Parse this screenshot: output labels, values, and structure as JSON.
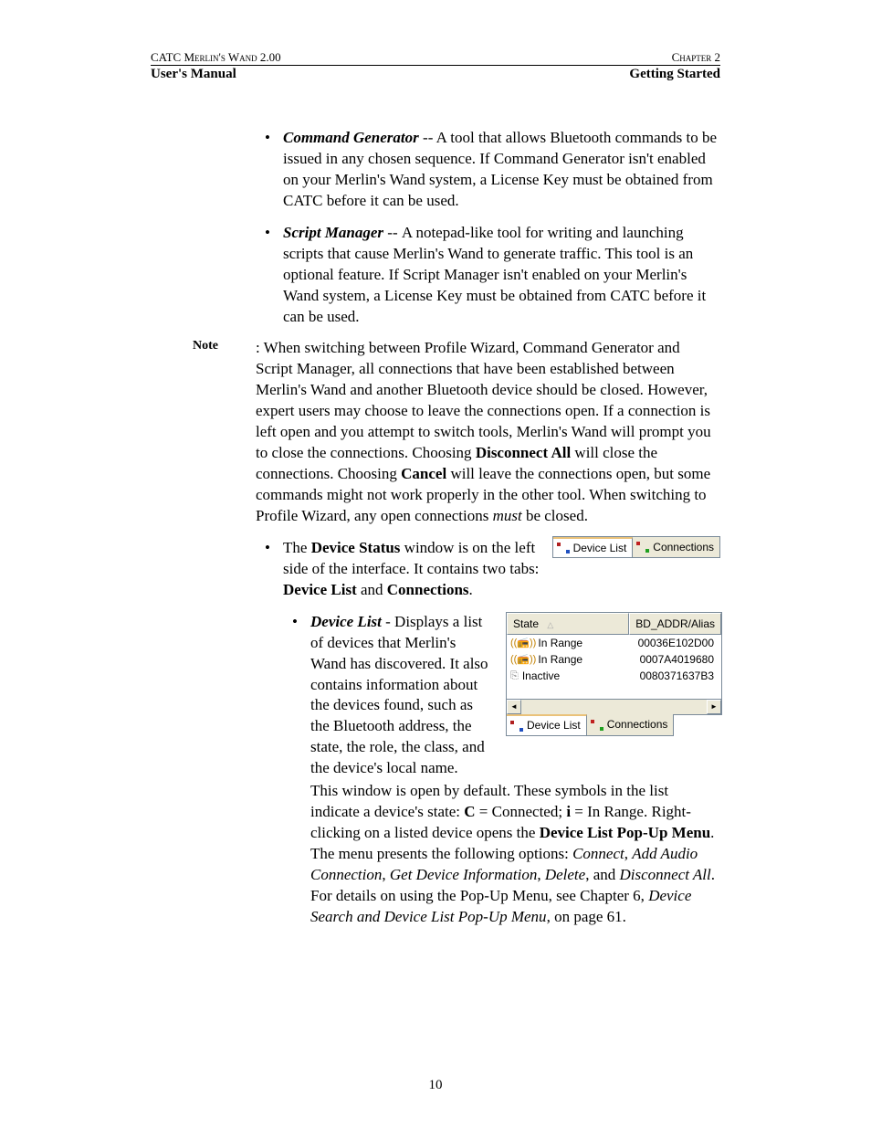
{
  "header": {
    "left": "CATC Merlin's Wand 2.00",
    "right": "Chapter 2"
  },
  "subheader": {
    "left": "User's Manual",
    "right": "Getting Started"
  },
  "cmdgen": {
    "title": "Command Generator",
    "sep": " -- ",
    "body": "A tool that allows Bluetooth commands to be issued in any chosen sequence. If Command Generator isn't enabled on your Merlin's Wand system, a License Key must be obtained from CATC before it can be used."
  },
  "scriptmgr": {
    "title": "Script Manager",
    "sep": " -- ",
    "body": "A notepad-like tool for writing and launching scripts that cause Merlin's Wand to generate traffic. This tool is an optional feature. If Script Manager isn't enabled on your Merlin's Wand system, a License Key must be obtained from CATC before it can be used."
  },
  "note": {
    "label": "Note",
    "colon": ": ",
    "p1": "When switching between Profile Wizard, Command Generator and Script Manager, all connections that have been established between Merlin's Wand and another Bluetooth device should be closed. However, expert users may choose to leave the connections open. If a connection is left open and you attempt to switch tools, Merlin's Wand will prompt you to close the connections. Choosing ",
    "da": "Disconnect All",
    "p2": " will close the connections. Choosing ",
    "cancel": "Cancel",
    "p3": " will leave the connections open, but some commands might not work properly in the other tool. When switching to Profile Wizard, any open connections ",
    "must": "must",
    "p4": " be closed."
  },
  "devstatus": {
    "p1": "The ",
    "b1": "Device Status",
    "p2": " window is on the left side of the interface. It contains two tabs: ",
    "b2": "Device List",
    "and": " and ",
    "b3": "Connections",
    "end": "."
  },
  "devlist": {
    "title": "Device List",
    "body": " - Displays a list of devices that Merlin's Wand has discovered. It also contains information about the devices found, such as the Bluetooth address, the state, the role, the class, and the device's local name."
  },
  "after": {
    "p1": "This window is open by default. These symbols in the list indicate a device's state: ",
    "C": "C",
    "eq1": " = Connected; ",
    "i": "i",
    "eq2": " = In Range. Right-clicking on a listed device opens the ",
    "b1": "Device List Pop-Up Menu",
    "p2": ". The menu presents the following options: ",
    "i1": "Connect",
    "c1": ", ",
    "i2": "Add Audio Connection",
    "c2": ", ",
    "i3": "Get Device Information",
    "c3": ", ",
    "i4": "Delete",
    "c4": ", and ",
    "i5": "Disconnect All",
    "p3": ". For details on using the Pop-Up Menu, see Chapter 6, ",
    "i6": "Device Search and Device List Pop-Up Menu",
    "p4": ", on page 61."
  },
  "tabs": {
    "t1": "Device List",
    "t2": "Connections"
  },
  "table": {
    "h1": "State",
    "h2": "BD_ADDR/Alias",
    "rows": [
      {
        "state": "In Range",
        "addr": "00036E102D00",
        "icon": "inrange"
      },
      {
        "state": "In Range",
        "addr": "0007A4019680",
        "icon": "inrange"
      },
      {
        "state": "Inactive",
        "addr": "0080371637B3",
        "icon": "inactive"
      }
    ]
  },
  "scroll": {
    "left": "◄",
    "right": "►"
  },
  "sort_glyph": "△",
  "pagenum": "10"
}
